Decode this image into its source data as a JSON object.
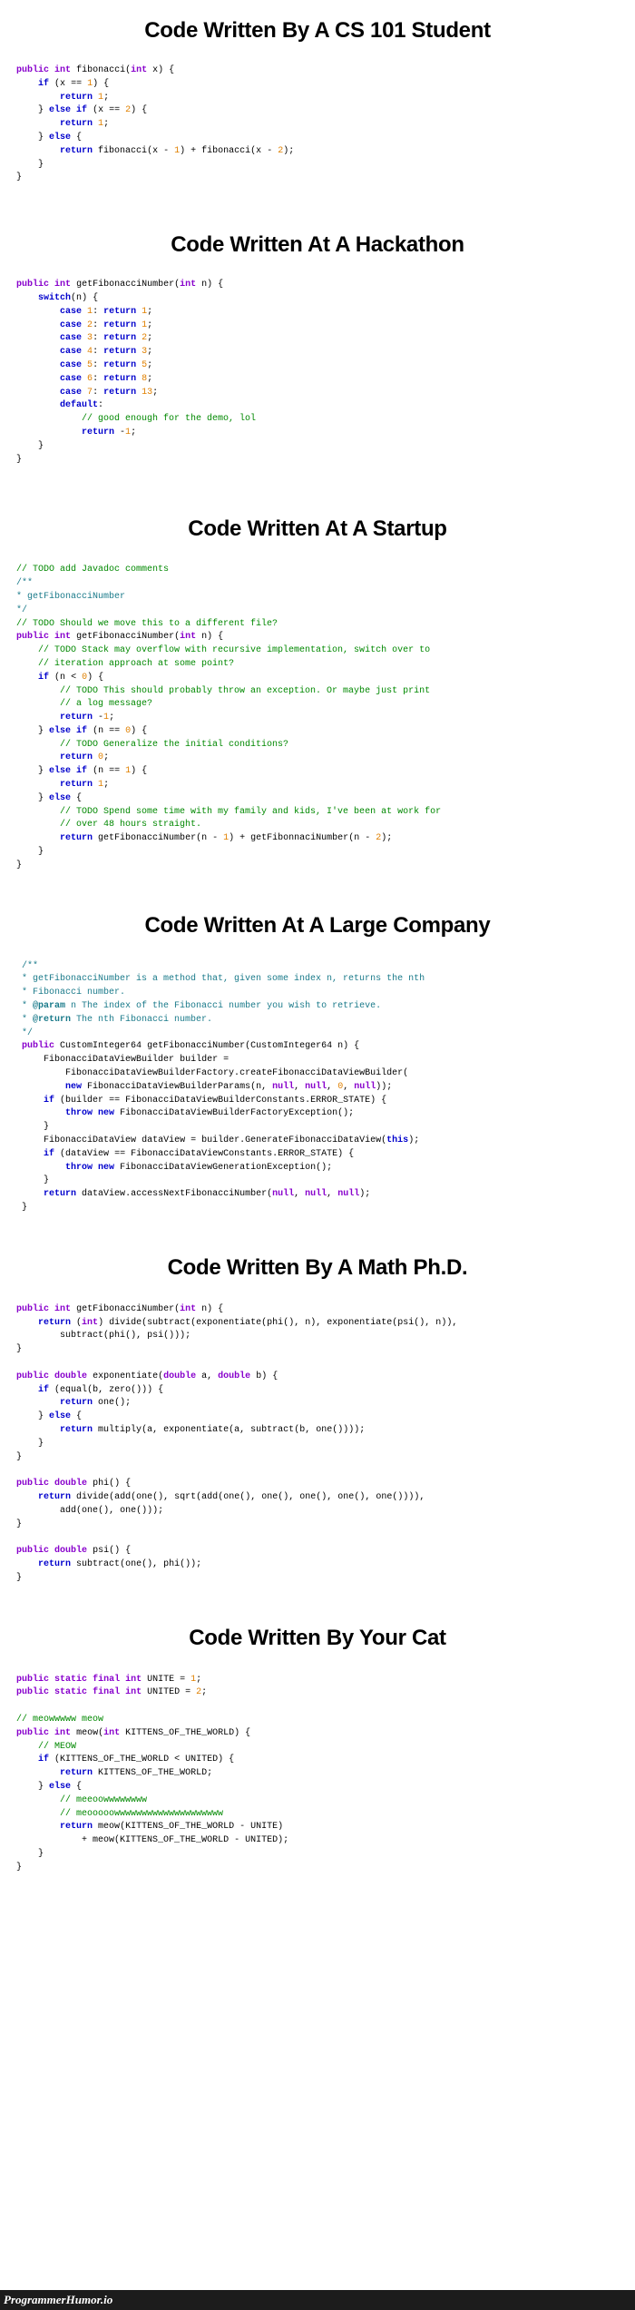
{
  "meme": {
    "watermark": "ProgrammerHumor.io",
    "background": "#ffffff",
    "footer_background": "#1c1c1c",
    "footer_text_color": "#ffffff"
  },
  "syntax_colors": {
    "keyword": "#0000cc",
    "modifier": "#8800cc",
    "type": "#8800cc",
    "number": "#e08000",
    "comment": "#008800",
    "javadoc": "#1a7a8a",
    "plain": "#000000"
  },
  "sections": [
    {
      "id": "cs101",
      "title": "Code Written By A CS 101 Student",
      "code": "public int fibonacci(int x) {\n    if (x == 1) {\n        return 1;\n    } else if (x == 2) {\n        return 1;\n    } else {\n        return fibonacci(x - 1) + fibonacci(x - 2);\n    }\n}"
    },
    {
      "id": "hackathon",
      "title": "Code Written At A Hackathon",
      "code": "public int getFibonacciNumber(int n) {\n    switch(n) {\n        case 1: return 1;\n        case 2: return 1;\n        case 3: return 2;\n        case 4: return 3;\n        case 5: return 5;\n        case 6: return 8;\n        case 7: return 13;\n        default:\n            // good enough for the demo, lol\n            return -1;\n    }\n}"
    },
    {
      "id": "startup",
      "title": "Code Written At A Startup",
      "code": "// TODO add Javadoc comments\n/**\n* getFibonacciNumber\n*/\n// TODO Should we move this to a different file?\npublic int getFibonacciNumber(int n) {\n    // TODO Stack may overflow with recursive implementation, switch over to\n    // iteration approach at some point?\n    if (n < 0) {\n        // TODO This should probably throw an exception. Or maybe just print\n        // a log message?\n        return -1;\n    } else if (n == 0) {\n        // TODO Generalize the initial conditions?\n        return 0;\n    } else if (n == 1) {\n        return 1;\n    } else {\n        // TODO Spend some time with my family and kids, I've been at work for\n        // over 48 hours straight.\n        return getFibonacciNumber(n - 1) + getFibonnaciNumber(n - 2);\n    }\n}"
    },
    {
      "id": "large-company",
      "title": "Code Written At A Large Company",
      "code": "/**\n* getFibonacciNumber is a method that, given some index n, returns the nth\n* Fibonacci number.\n* @param n The index of the Fibonacci number you wish to retrieve.\n* @return The nth Fibonacci number.\n*/\npublic CustomInteger64 getFibonacciNumber(CustomInteger64 n) {\n    FibonacciDataViewBuilder builder =\n        FibonacciDataViewBuilderFactory.createFibonacciDataViewBuilder(\n        new FibonacciDataViewBuilderParams(n, null, null, 0, null));\n    if (builder == FibonacciDataViewBuilderConstants.ERROR_STATE) {\n        throw new FibonacciDataViewBuilderFactoryException();\n    }\n    FibonacciDataView dataView = builder.GenerateFibonacciDataView(this);\n    if (dataView == FibonacciDataViewConstants.ERROR_STATE) {\n        throw new FibonacciDataViewGenerationException();\n    }\n    return dataView.accessNextFibonacciNumber(null, null, null);\n}"
    },
    {
      "id": "math-phd",
      "title": "Code Written By A Math Ph.D.",
      "code": "public int getFibonacciNumber(int n) {\n    return (int) divide(subtract(exponentiate(phi(), n), exponentiate(psi(), n)),\n        subtract(phi(), psi()));\n}\n\npublic double exponentiate(double a, double b) {\n    if (equal(b, zero())) {\n        return one();\n    } else {\n        return multiply(a, exponentiate(a, subtract(b, one())));\n    }\n}\n\npublic double phi() {\n    return divide(add(one(), sqrt(add(one(), one(), one(), one(), one()))),\n        add(one(), one()));\n}\n\npublic double psi() {\n    return subtract(one(), phi());\n}"
    },
    {
      "id": "your-cat",
      "title": "Code Written By Your Cat",
      "code": "public static final int UNITE = 1;\npublic static final int UNITED = 2;\n\n// meowwwww meow\npublic int meow(int KITTENS_OF_THE_WORLD) {\n    // MEOW\n    if (KITTENS_OF_THE_WORLD < UNITED) {\n        return KITTENS_OF_THE_WORLD;\n    } else {\n        // meeoowwwwwwww\n        // meooooowwwwwwwwwwwwwwwwwwww\n        return meow(KITTENS_OF_THE_WORLD - UNITE)\n            + meow(KITTENS_OF_THE_WORLD - UNITED);\n    }\n}"
    }
  ]
}
